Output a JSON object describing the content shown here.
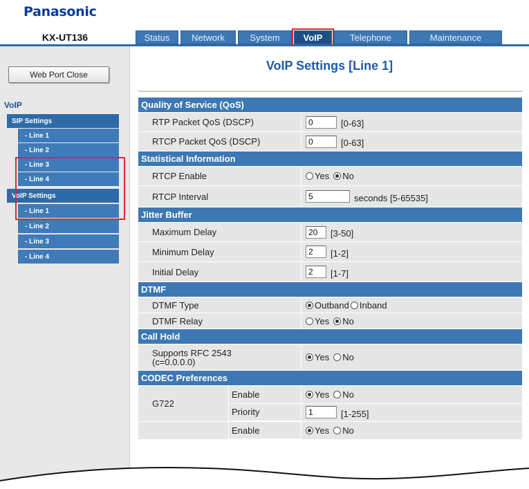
{
  "brand": "Panasonic",
  "model": "KX-UT136",
  "tabs": [
    {
      "label": "Status",
      "active": false
    },
    {
      "label": "Network",
      "active": false
    },
    {
      "label": "System",
      "active": false
    },
    {
      "label": "VoIP",
      "active": true
    },
    {
      "label": "Telephone",
      "active": false
    },
    {
      "label": "Maintenance",
      "active": false
    }
  ],
  "sidebar": {
    "web_port_button": "Web Port Close",
    "heading": "VoIP",
    "sip_group": "SIP Settings",
    "sip_lines": [
      "- Line 1",
      "- Line 2",
      "- Line 3",
      "- Line 4"
    ],
    "voip_group": "VoIP Settings",
    "voip_lines": [
      "- Line 1",
      "- Line 2",
      "- Line 3",
      "- Line 4"
    ]
  },
  "page_title": "VoIP Settings [Line 1]",
  "sections": {
    "qos": {
      "title": "Quality of Service (QoS)",
      "rtp_label": "RTP Packet QoS (DSCP)",
      "rtp_value": "0",
      "rtp_range": "[0-63]",
      "rtcp_label": "RTCP Packet QoS (DSCP)",
      "rtcp_value": "0",
      "rtcp_range": "[0-63]"
    },
    "stats": {
      "title": "Statistical Information",
      "enable_label": "RTCP Enable",
      "enable_yes": "Yes",
      "enable_no": "No",
      "enable_selected": "No",
      "interval_label": "RTCP Interval",
      "interval_value": "5",
      "interval_range": "seconds [5-65535]"
    },
    "jitter": {
      "title": "Jitter Buffer",
      "max_label": "Maximum Delay",
      "max_value": "20",
      "max_range": "[3-50]",
      "min_label": "Minimum Delay",
      "min_value": "2",
      "min_range": "[1-2]",
      "init_label": "Initial Delay",
      "init_value": "2",
      "init_range": "[1-7]"
    },
    "dtmf": {
      "title": "DTMF",
      "type_label": "DTMF Type",
      "type_out": "Outband",
      "type_in": "Inband",
      "type_selected": "Outband",
      "relay_label": "DTMF Relay",
      "relay_yes": "Yes",
      "relay_no": "No",
      "relay_selected": "No"
    },
    "hold": {
      "title": "Call Hold",
      "rfc_label_1": "Supports RFC 2543",
      "rfc_label_2": "(c=0.0.0.0)",
      "rfc_yes": "Yes",
      "rfc_no": "No",
      "rfc_selected": "Yes"
    },
    "codec": {
      "title": "CODEC Preferences",
      "g722_label": "G722",
      "enable_label": "Enable",
      "enable_yes": "Yes",
      "enable_no": "No",
      "enable_selected": "Yes",
      "priority_label": "Priority",
      "priority_value": "1",
      "priority_range": "[1-255]",
      "enable2_label": "Enable",
      "enable2_yes": "Yes",
      "enable2_no": "No",
      "enable2_selected": "Yes"
    }
  },
  "colors": {
    "accent": "#3d78b4",
    "title": "#1d5ba6",
    "highlight": "#e0262f"
  }
}
